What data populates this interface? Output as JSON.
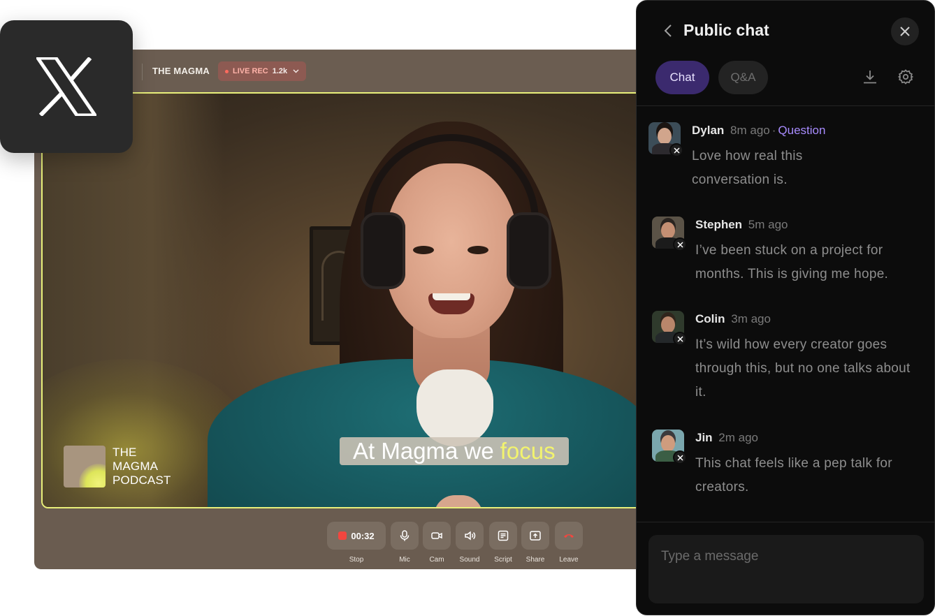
{
  "studio": {
    "show_title": "THE MAGMA",
    "live_label": "LIVE REC",
    "viewer_count": "1.2k",
    "podcast_logo_lines": [
      "THE",
      "MAGMA",
      "PODCAST"
    ],
    "caption_text": "At Magma we",
    "caption_highlight": "focus",
    "accent_color": "#e9f07a",
    "controls": [
      {
        "icon": "record-stop-icon",
        "label": "Stop",
        "value": "00:32"
      },
      {
        "icon": "mic-icon",
        "label": "Mic"
      },
      {
        "icon": "camera-icon",
        "label": "Cam"
      },
      {
        "icon": "speaker-icon",
        "label": "Sound"
      },
      {
        "icon": "script-icon",
        "label": "Script"
      },
      {
        "icon": "share-screen-icon",
        "label": "Share"
      },
      {
        "icon": "phone-hangup-icon",
        "label": "Leave"
      }
    ]
  },
  "x_app_icon": "x-logo-icon",
  "chat": {
    "title": "Public chat",
    "tabs": [
      {
        "label": "Chat",
        "active": true
      },
      {
        "label": "Q&A",
        "active": false
      }
    ],
    "tab_active_color": "#3b2a6e",
    "tag_color": "#a88cff",
    "messages": [
      {
        "name": "Dylan",
        "time": "8m ago",
        "tag": "Question",
        "text": "Love how real this conversation is."
      },
      {
        "name": "Stephen",
        "time": "5m ago",
        "text": "I’ve been stuck on a project for months. This is giving me hope."
      },
      {
        "name": "Colin",
        "time": "3m ago",
        "text": "It’s wild how every creator goes through this, but no one talks about it."
      },
      {
        "name": "Jin",
        "time": "2m ago",
        "text": "This chat feels like a pep talk for creators."
      }
    ],
    "input_placeholder": "Type a message"
  }
}
